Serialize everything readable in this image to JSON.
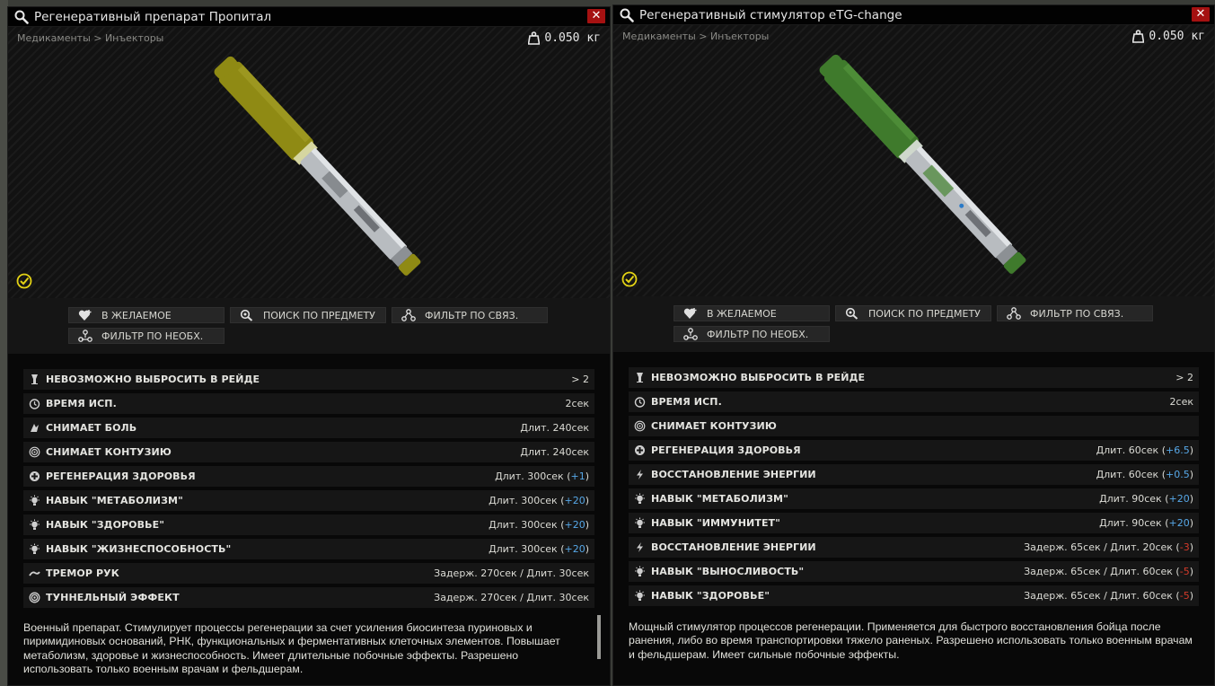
{
  "left": {
    "title": "Регенеративный препарат Пропитал",
    "close": "✕",
    "breadcrumb": "Медикаменты > Инъекторы",
    "weight": "0.050 кг",
    "injector_color": "#8f8a14",
    "actions": {
      "wishlist": "В ЖЕЛАЕМОЕ",
      "search": "ПОИСК ПО ПРЕДМЕТУ",
      "filter_linked": "ФИЛЬТР ПО СВЯЗ.",
      "filter_required": "ФИЛЬТР ПО НЕОБХ."
    },
    "stats": [
      {
        "icon": "no-drop-icon",
        "label": "НЕВОЗМОЖНО ВЫБРОСИТЬ В РЕЙДЕ",
        "value": "> 2",
        "mod": "",
        "close": "",
        "mod_class": ""
      },
      {
        "icon": "clock-icon",
        "label": "ВРЕМЯ ИСП.",
        "value": "2сек",
        "mod": "",
        "close": "",
        "mod_class": ""
      },
      {
        "icon": "painkiller-icon",
        "label": "СНИМАЕТ БОЛЬ",
        "value": "Длит. 240сек",
        "mod": "",
        "close": "",
        "mod_class": ""
      },
      {
        "icon": "contusion-icon",
        "label": "СНИМАЕТ КОНТУЗИЮ",
        "value": "Длит. 240сек",
        "mod": "",
        "close": "",
        "mod_class": ""
      },
      {
        "icon": "health-regen-icon",
        "label": "РЕГЕНЕРАЦИЯ ЗДОРОВЬЯ",
        "value": "Длит. 300сек (",
        "mod": "+1",
        "close": ")",
        "mod_class": "pos"
      },
      {
        "icon": "skill-icon",
        "label": "НАВЫК \"МЕТАБОЛИЗМ\"",
        "value": "Длит. 300сек (",
        "mod": "+20",
        "close": ")",
        "mod_class": "pos"
      },
      {
        "icon": "skill-icon",
        "label": "НАВЫК \"ЗДОРОВЬЕ\"",
        "value": "Длит. 300сек (",
        "mod": "+20",
        "close": ")",
        "mod_class": "pos"
      },
      {
        "icon": "skill-icon",
        "label": "НАВЫК \"ЖИЗНЕСПОСОБНОСТЬ\"",
        "value": "Длит. 300сек (",
        "mod": "+20",
        "close": ")",
        "mod_class": "pos"
      },
      {
        "icon": "tremor-icon",
        "label": "ТРЕМОР РУК",
        "value": "Задерж. 270сек / Длит. 30сек",
        "mod": "",
        "close": "",
        "mod_class": ""
      },
      {
        "icon": "tunnel-icon",
        "label": "ТУННЕЛЬНЫЙ ЭФФЕКТ",
        "value": "Задерж. 270сек / Длит. 30сек",
        "mod": "",
        "close": "",
        "mod_class": ""
      }
    ],
    "description": "Военный препарат. Стимулирует процессы регенерации за счет усиления биосинтеза пуриновых и пиримидиновых оснований, РНК, функциональных и ферментативных клеточных элементов. Повышает метаболизм, здоровье и жизнеспособность. Имеет длительные побочные эффекты. Разрешено использовать только военным врачам и фельдшерам."
  },
  "right": {
    "title": "Регенеративный стимулятор eTG-change",
    "close": "✕",
    "breadcrumb": "Медикаменты > Инъекторы",
    "weight": "0.050 кг",
    "injector_color": "#3f7a2c",
    "actions": {
      "wishlist": "В ЖЕЛАЕМОЕ",
      "search": "ПОИСК ПО ПРЕДМЕТУ",
      "filter_linked": "ФИЛЬТР ПО СВЯЗ.",
      "filter_required": "ФИЛЬТР ПО НЕОБХ."
    },
    "stats": [
      {
        "icon": "no-drop-icon",
        "label": "НЕВОЗМОЖНО ВЫБРОСИТЬ В РЕЙДЕ",
        "value": "> 2",
        "mod": "",
        "close": "",
        "mod_class": ""
      },
      {
        "icon": "clock-icon",
        "label": "ВРЕМЯ ИСП.",
        "value": "2сек",
        "mod": "",
        "close": "",
        "mod_class": ""
      },
      {
        "icon": "contusion-icon",
        "label": "СНИМАЕТ КОНТУЗИЮ",
        "value": "",
        "mod": "",
        "close": "",
        "mod_class": ""
      },
      {
        "icon": "health-regen-icon",
        "label": "РЕГЕНЕРАЦИЯ ЗДОРОВЬЯ",
        "value": "Длит. 60сек (",
        "mod": "+6.5",
        "close": ")",
        "mod_class": "pos"
      },
      {
        "icon": "energy-icon",
        "label": "ВОССТАНОВЛЕНИЕ ЭНЕРГИИ",
        "value": "Длит. 60сек (",
        "mod": "+0.5",
        "close": ")",
        "mod_class": "pos"
      },
      {
        "icon": "skill-icon",
        "label": "НАВЫК \"МЕТАБОЛИЗМ\"",
        "value": "Длит. 90сек (",
        "mod": "+20",
        "close": ")",
        "mod_class": "pos"
      },
      {
        "icon": "skill-icon",
        "label": "НАВЫК \"ИММУНИТЕТ\"",
        "value": "Длит. 90сек (",
        "mod": "+20",
        "close": ")",
        "mod_class": "pos"
      },
      {
        "icon": "energy-icon",
        "label": "ВОССТАНОВЛЕНИЕ ЭНЕРГИИ",
        "value": "Задерж. 65сек / Длит. 20сек (",
        "mod": "-3",
        "close": ")",
        "mod_class": "neg"
      },
      {
        "icon": "skill-icon",
        "label": "НАВЫК \"ВЫНОСЛИВОСТЬ\"",
        "value": "Задерж. 65сек / Длит. 60сек (",
        "mod": "-5",
        "close": ")",
        "mod_class": "neg"
      },
      {
        "icon": "skill-icon",
        "label": "НАВЫК \"ЗДОРОВЬЕ\"",
        "value": "Задерж. 65сек / Длит. 60сек (",
        "mod": "-5",
        "close": ")",
        "mod_class": "neg"
      }
    ],
    "description": "Мощный стимулятор процессов регенерации. Применяется для быстрого восстановления бойца после ранения, либо во время транспортировки тяжело раненых. Разрешено использовать только военным врачам и фельдшерам. Имеет сильные побочные эффекты."
  }
}
